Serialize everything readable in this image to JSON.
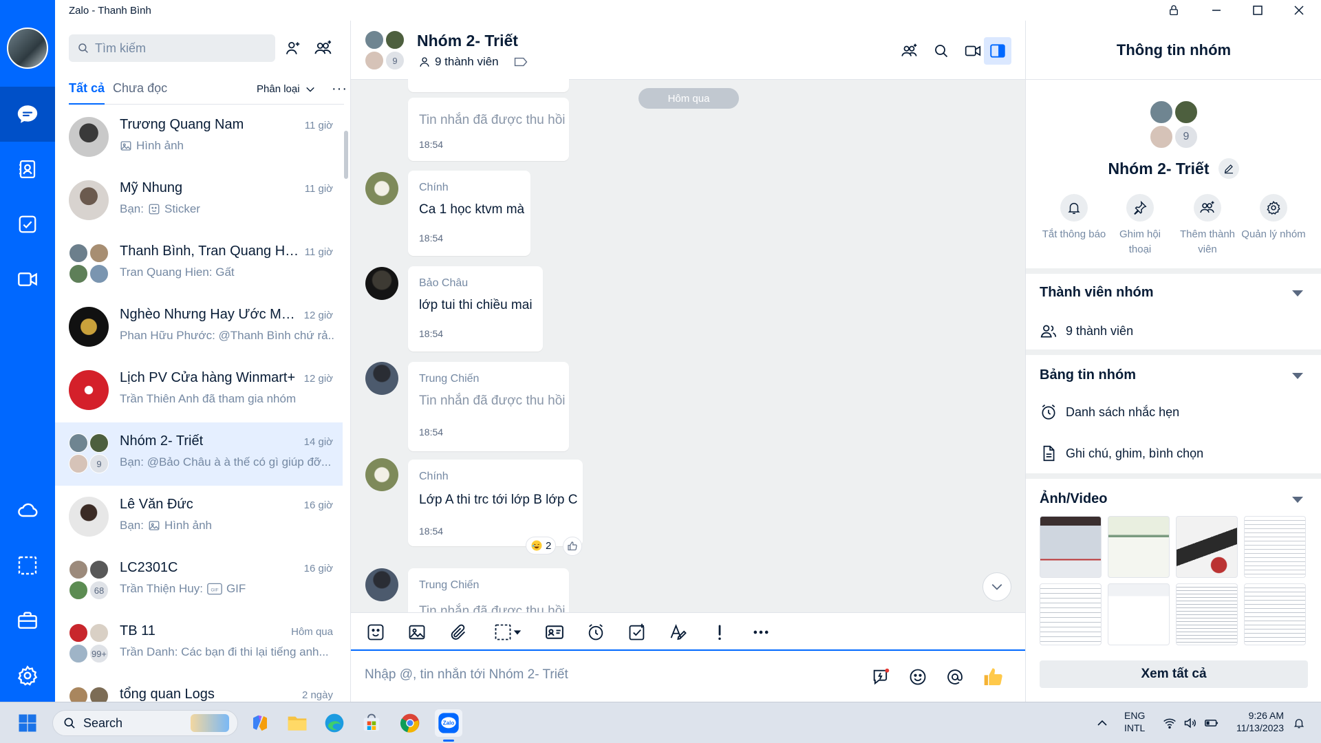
{
  "window": {
    "title": "Zalo - Thanh Bình"
  },
  "search": {
    "placeholder": "Tìm kiếm"
  },
  "filters": {
    "all": "Tất cả",
    "unread": "Chưa đọc",
    "sort": "Phân loại",
    "more": "···"
  },
  "conversations": [
    {
      "name": "Trương Quang Nam",
      "time": "11 giờ",
      "preview": "Hình ảnh",
      "preview_icon": "image-icon"
    },
    {
      "name": "Mỹ Nhung",
      "time": "11 giờ",
      "preview_prefix": "Bạn:",
      "preview": "Sticker",
      "preview_icon": "sticker-icon"
    },
    {
      "name": "Thanh Bình, Tran Quang Hie...",
      "time": "11 giờ",
      "preview": "Tran Quang Hien: Gất"
    },
    {
      "name": "Nghèo Nhưng Hay Ước Mơ ...",
      "time": "12 giờ",
      "preview": "Phan Hữu Phước: @Thanh Bình chứ rả..."
    },
    {
      "name": "Lịch PV Cửa hàng Winmart+",
      "time": "12 giờ",
      "preview": "Trần Thiên Anh đã tham gia nhóm"
    },
    {
      "name": "Nhóm 2- Triết",
      "time": "14 giờ",
      "preview": "Bạn: @Bảo Châu à à thế có gì giúp đỡ...",
      "count": "9"
    },
    {
      "name": "Lê Văn Đức",
      "time": "16 giờ",
      "preview_prefix": "Bạn:",
      "preview": "Hình ảnh",
      "preview_icon": "image-icon"
    },
    {
      "name": "LC2301C",
      "time": "16 giờ",
      "preview_prefix": "Trần Thiện Huy:",
      "preview": "GIF",
      "preview_icon": "gif-icon",
      "count": "68"
    },
    {
      "name": "TB 11",
      "time": "Hôm qua",
      "preview": "Trần Danh: Các bạn đi thi lại tiếng anh...",
      "count": "99+"
    },
    {
      "name": "tổng quan Logs",
      "time": "2 ngày",
      "preview": ""
    }
  ],
  "chat": {
    "name": "Nhóm 2- Triết",
    "members": "9 thành viên",
    "group_count": "9",
    "day_separator": "Hôm qua",
    "messages": [
      {
        "sender": "",
        "text": "Tin nhắn đã được thu hồi",
        "time": "18:54"
      },
      {
        "sender": "Chính",
        "text": "Ca 1 học ktvm mà",
        "time": "18:54"
      },
      {
        "sender": "Bảo Châu",
        "text": "lớp tui thi chiều mai",
        "time": "18:54"
      },
      {
        "sender": "Trung Chiến",
        "text": "Tin nhắn đã được thu hồi",
        "time": "18:54"
      },
      {
        "sender": "Chính",
        "text": "Lớp A thi trc tới lớp B lớp C",
        "time": "18:54",
        "reaction_count": "2"
      },
      {
        "sender": "Trung Chiến",
        "text": "Tin nhắn đã được thu hồi",
        "time": ""
      }
    ],
    "input_placeholder": "Nhập @, tin nhắn tới Nhóm 2- Triết"
  },
  "info": {
    "header": "Thông tin nhóm",
    "group_name": "Nhóm 2- Triết",
    "group_count": "9",
    "actions": [
      {
        "label": "Tắt thông báo",
        "icon": "bell-icon"
      },
      {
        "label": "Ghim hội thoại",
        "icon": "pin-icon"
      },
      {
        "label": "Thêm thành viên",
        "icon": "add-member-icon"
      },
      {
        "label": "Quản lý nhóm",
        "icon": "gear-icon"
      }
    ],
    "members_section": "Thành viên nhóm",
    "members_count": "9 thành viên",
    "board_section": "Bảng tin nhóm",
    "reminders": "Danh sách nhắc hẹn",
    "notes": "Ghi chú, ghim, bình chọn",
    "media_section": "Ảnh/Video",
    "see_all": "Xem tất cả"
  },
  "taskbar": {
    "search": "Search",
    "lang_top": "ENG",
    "lang_bottom": "INTL",
    "time": "9:26 AM",
    "date": "11/13/2023"
  },
  "colors": {
    "accent": "#0068ff",
    "rail": "#0068ff",
    "active_conv": "#e5efff",
    "chat_bg": "#eef0f1"
  }
}
